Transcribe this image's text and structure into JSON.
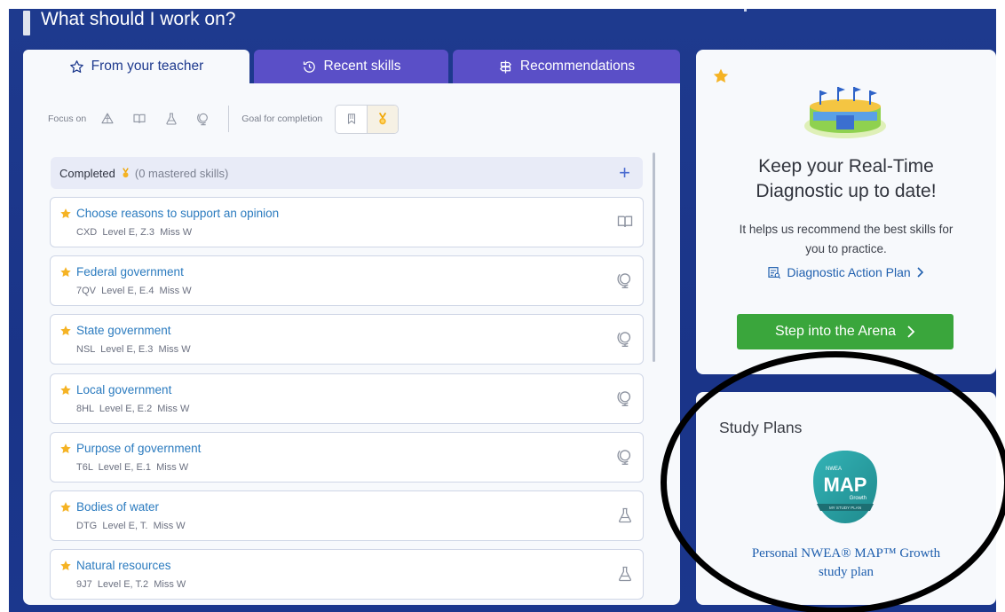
{
  "heading": "What should I work on?",
  "tabs": {
    "from_teacher": "From your teacher",
    "recent": "Recent skills",
    "recommendations": "Recommendations"
  },
  "filters": {
    "focus_label": "Focus on",
    "goal_label": "Goal for completion"
  },
  "completed": {
    "label": "Completed",
    "count": "(0 mastered skills)",
    "plus": "+"
  },
  "skills": [
    {
      "name": "Choose reasons to support an opinion",
      "meta": "CXD  Level E, Z.3  Miss W",
      "subject_icon": "book-icon"
    },
    {
      "name": "Federal government",
      "meta": "7QV  Level E, E.4  Miss W",
      "subject_icon": "globe-icon"
    },
    {
      "name": "State government",
      "meta": "NSL  Level E, E.3  Miss W",
      "subject_icon": "globe-icon"
    },
    {
      "name": "Local government",
      "meta": "8HL  Level E, E.2  Miss W",
      "subject_icon": "globe-icon"
    },
    {
      "name": "Purpose of government",
      "meta": "T6L  Level E, E.1  Miss W",
      "subject_icon": "globe-icon"
    },
    {
      "name": "Bodies of water",
      "meta": "DTG  Level E, T.  Miss W",
      "subject_icon": "flask-icon"
    },
    {
      "name": "Natural resources",
      "meta": "9J7  Level E, T.2  Miss W",
      "subject_icon": "flask-icon"
    }
  ],
  "diagnostic": {
    "title_line1": "Keep your Real-Time",
    "title_line2": "Diagnostic up to date!",
    "desc_line1": "It helps us recommend the best skills for",
    "desc_line2": "you to practice.",
    "link": "Diagnostic Action Plan",
    "button": "Step into the Arena"
  },
  "study": {
    "title": "Study Plans",
    "logo_top": "NWEA",
    "logo_main": "MAP",
    "logo_sub": "Growth",
    "logo_band": "MY STUDY PLAN",
    "link_line1": "Personal NWEA® MAP™ Growth",
    "link_line2": "study plan"
  },
  "colors": {
    "background": "#1e3a8e",
    "tab_purple": "#5a4fc7",
    "link_blue": "#2b7bbf",
    "star_gold": "#f5b324",
    "button_green": "#3aa63c"
  }
}
